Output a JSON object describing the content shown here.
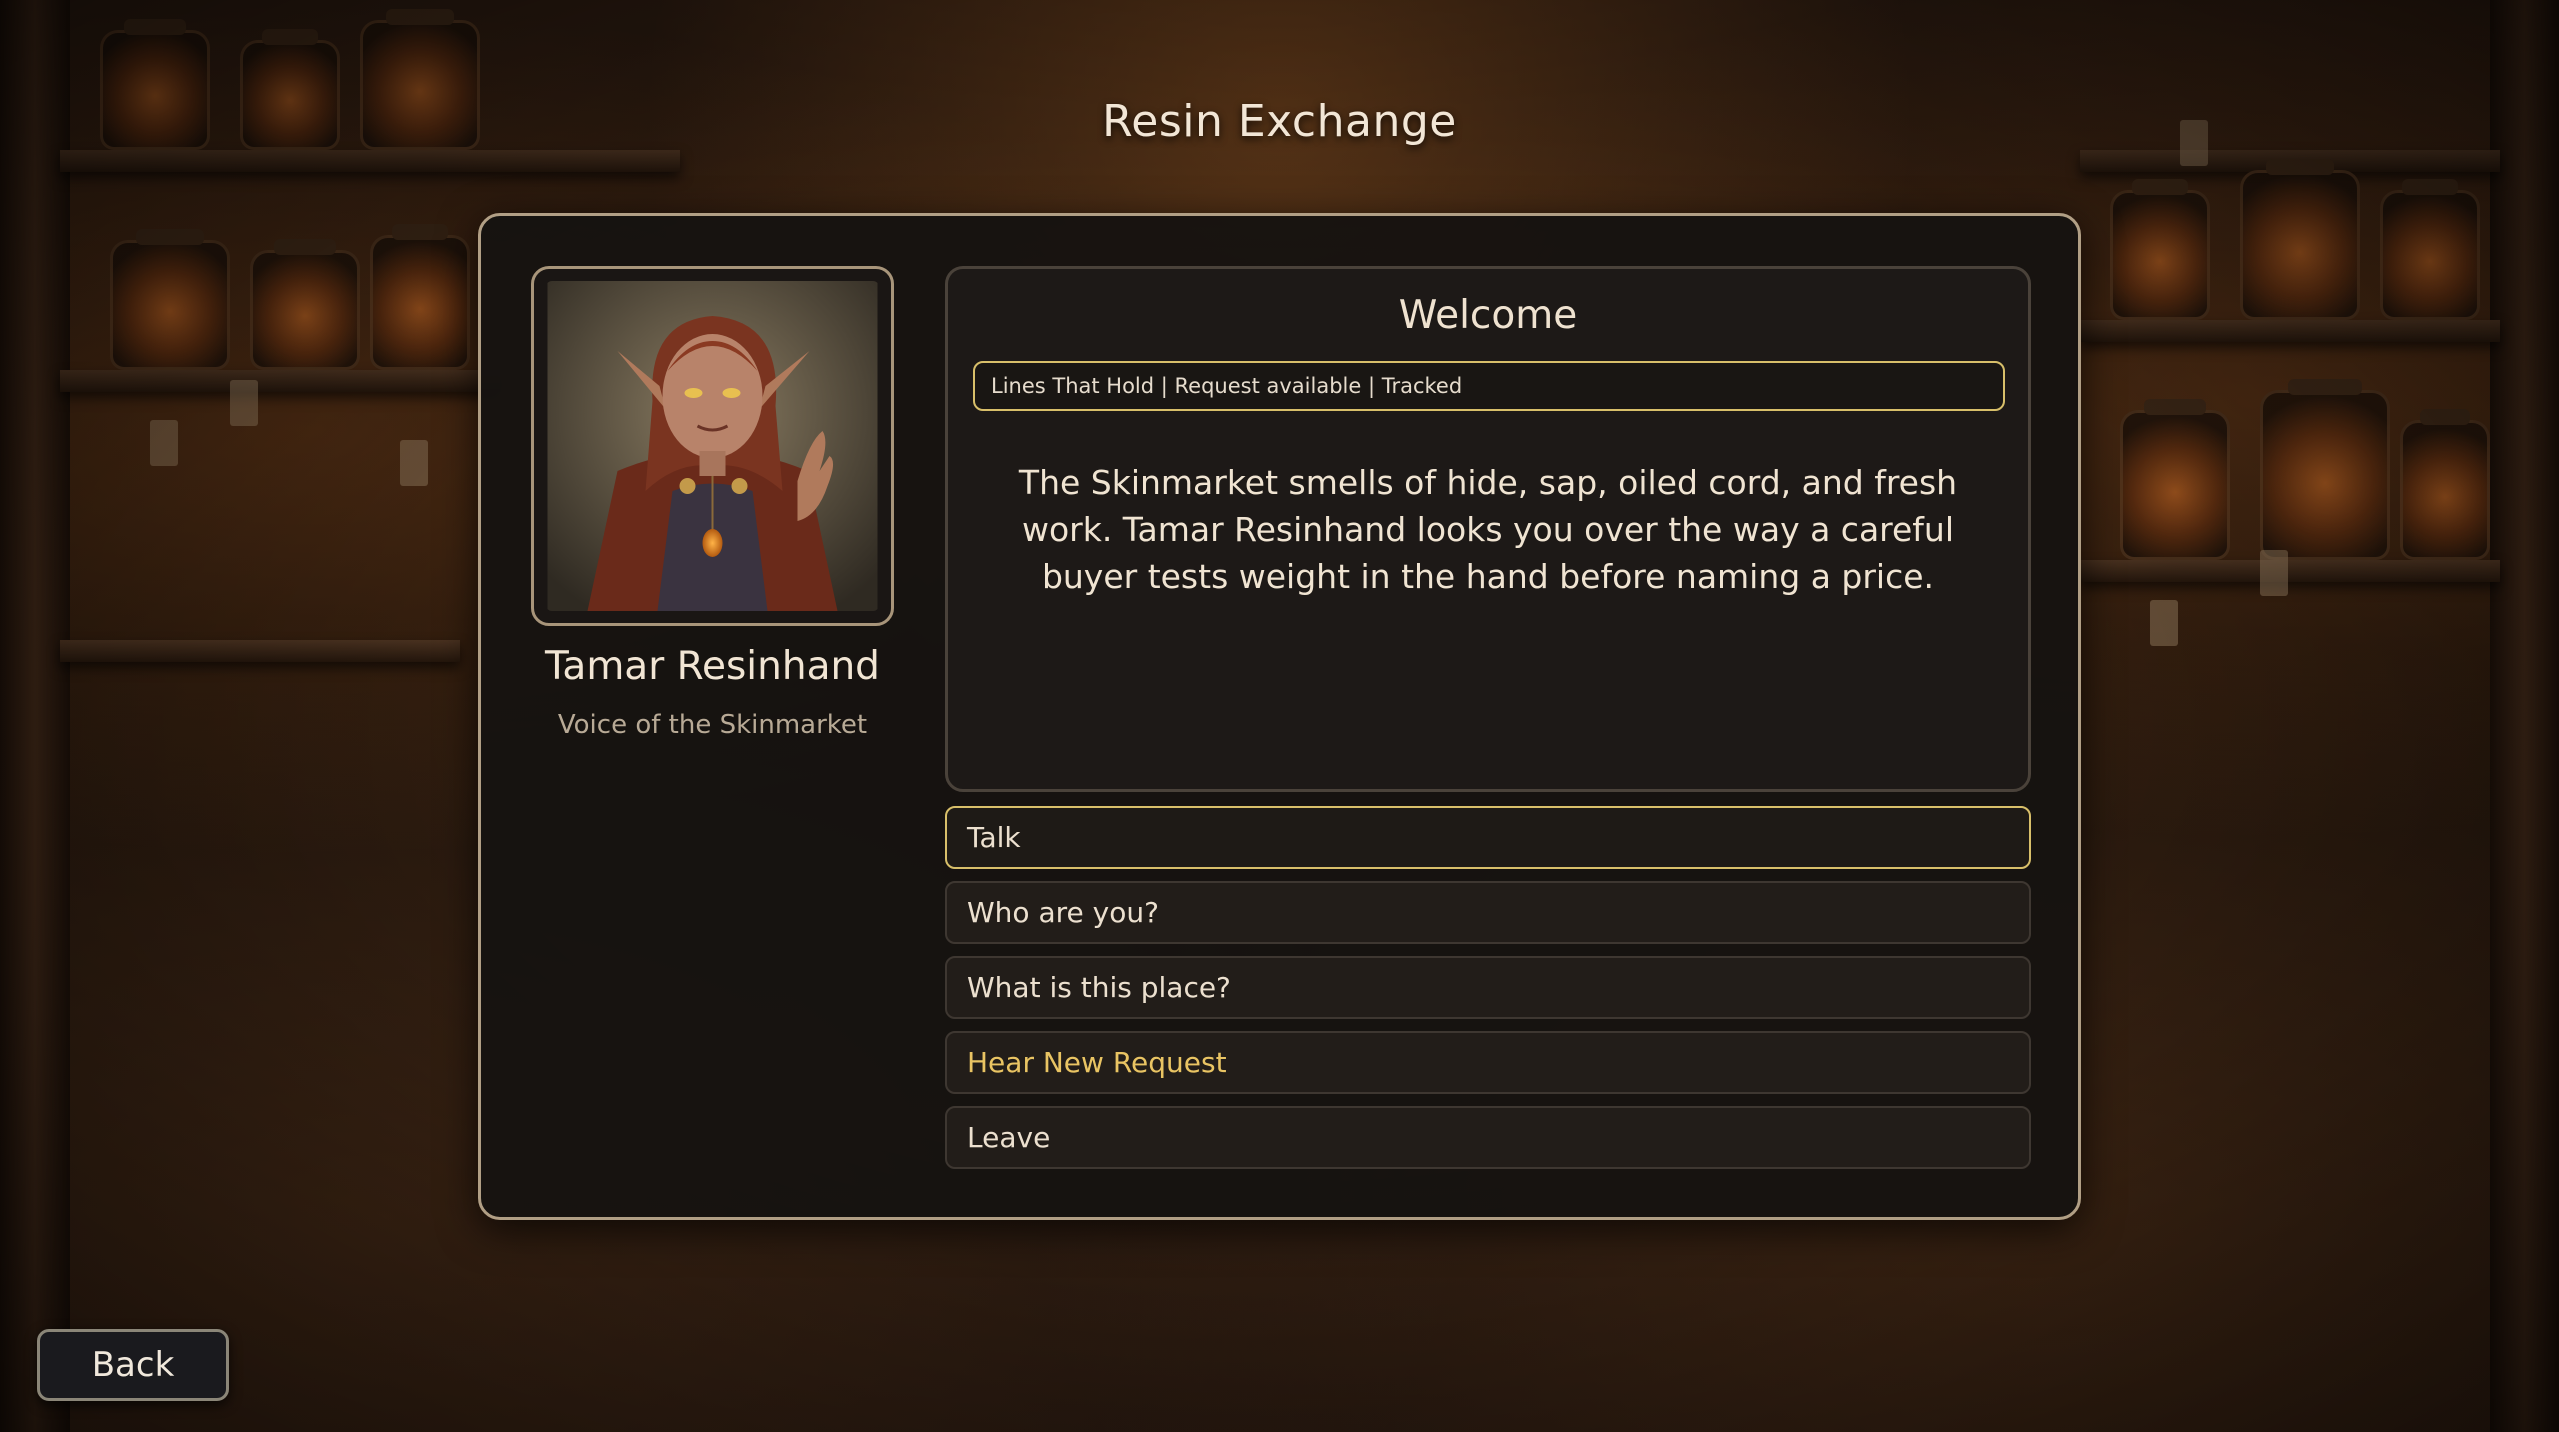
{
  "screen": {
    "title": "Resin Exchange"
  },
  "npc": {
    "name": "Tamar Resinhand",
    "title": "Voice of the Skinmarket",
    "portrait": "elf-merchant-portrait"
  },
  "dialog": {
    "heading": "Welcome",
    "status": "Lines That Hold | Request available | Tracked",
    "narration": "The Skinmarket smells of hide, sap, oiled cord, and fresh work. Tamar Resinhand looks you over the way a careful buyer tests weight in the hand before naming a price.",
    "options": [
      {
        "label": "Talk",
        "state": "selected"
      },
      {
        "label": "Who are you?",
        "state": "normal"
      },
      {
        "label": "What is this place?",
        "state": "normal"
      },
      {
        "label": "Hear New Request",
        "state": "highlight"
      },
      {
        "label": "Leave",
        "state": "normal"
      }
    ]
  },
  "footer": {
    "back_label": "Back"
  },
  "colors": {
    "accent_gold": "#d8bf6a",
    "request_text": "#e9c463",
    "panel_border": "#b19f85"
  }
}
